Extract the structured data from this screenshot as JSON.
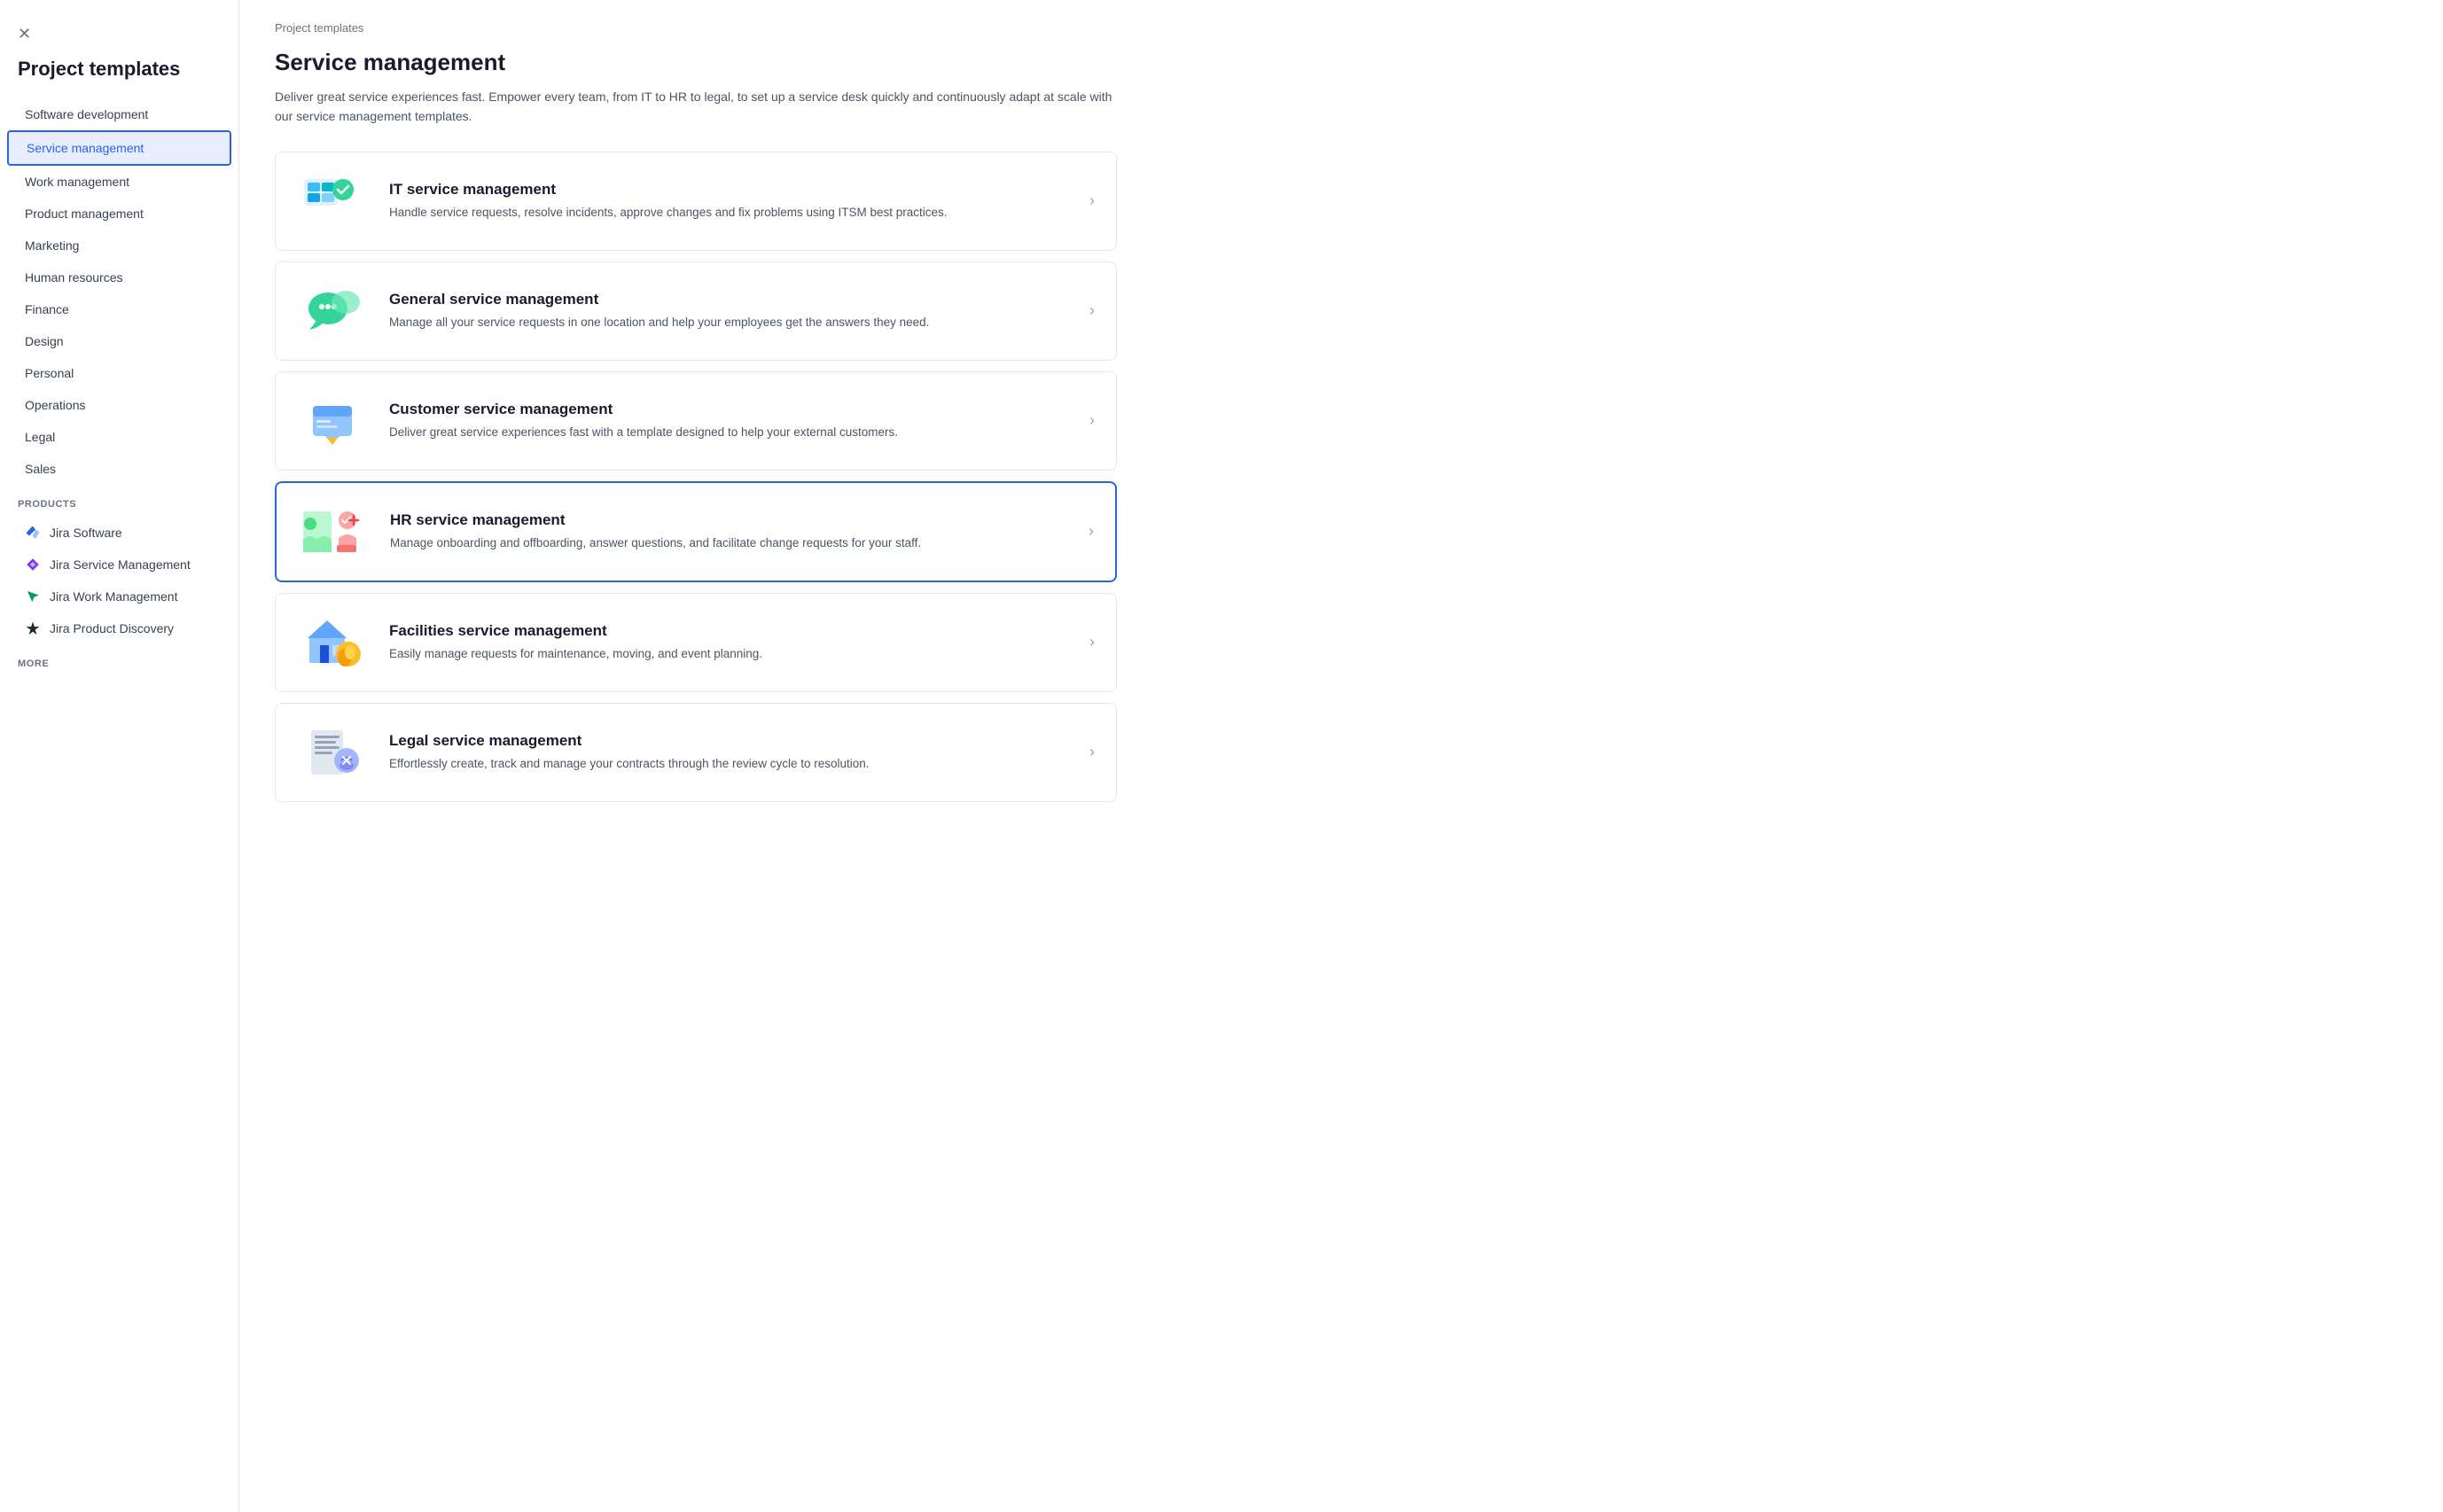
{
  "sidebar": {
    "close_icon": "×",
    "title": "Project templates",
    "nav_items": [
      {
        "label": "Software development",
        "active": false
      },
      {
        "label": "Service management",
        "active": true
      },
      {
        "label": "Work management",
        "active": false
      },
      {
        "label": "Product management",
        "active": false
      },
      {
        "label": "Marketing",
        "active": false
      },
      {
        "label": "Human resources",
        "active": false
      },
      {
        "label": "Finance",
        "active": false
      },
      {
        "label": "Design",
        "active": false
      },
      {
        "label": "Personal",
        "active": false
      },
      {
        "label": "Operations",
        "active": false
      },
      {
        "label": "Legal",
        "active": false
      },
      {
        "label": "Sales",
        "active": false
      }
    ],
    "products_label": "PRODUCTS",
    "products": [
      {
        "label": "Jira Software",
        "icon": "jira-software"
      },
      {
        "label": "Jira Service Management",
        "icon": "jira-service"
      },
      {
        "label": "Jira Work Management",
        "icon": "jira-work"
      },
      {
        "label": "Jira Product Discovery",
        "icon": "jira-discovery"
      }
    ],
    "more_label": "MORE"
  },
  "main": {
    "breadcrumb": "Project templates",
    "title": "Service management",
    "description": "Deliver great service experiences fast. Empower every team, from IT to HR to legal, to set up a service desk quickly and continuously adapt at scale with our service management templates.",
    "cards": [
      {
        "id": "it-service",
        "title": "IT service management",
        "description": "Handle service requests, resolve incidents, approve changes and fix problems using ITSM best practices.",
        "highlighted": false,
        "icon_type": "itsm"
      },
      {
        "id": "general-service",
        "title": "General service management",
        "description": "Manage all your service requests in one location and help your employees get the answers they need.",
        "highlighted": false,
        "icon_type": "general"
      },
      {
        "id": "customer-service",
        "title": "Customer service management",
        "description": "Deliver great service experiences fast with a template designed to help your external customers.",
        "highlighted": false,
        "icon_type": "customer"
      },
      {
        "id": "hr-service",
        "title": "HR service management",
        "description": "Manage onboarding and offboarding, answer questions, and facilitate change requests for your staff.",
        "highlighted": true,
        "icon_type": "hr"
      },
      {
        "id": "facilities-service",
        "title": "Facilities service management",
        "description": "Easily manage requests for maintenance, moving, and event planning.",
        "highlighted": false,
        "icon_type": "facilities"
      },
      {
        "id": "legal-service",
        "title": "Legal service management",
        "description": "Effortlessly create, track and manage your contracts through the review cycle to resolution.",
        "highlighted": false,
        "icon_type": "legal"
      }
    ]
  }
}
